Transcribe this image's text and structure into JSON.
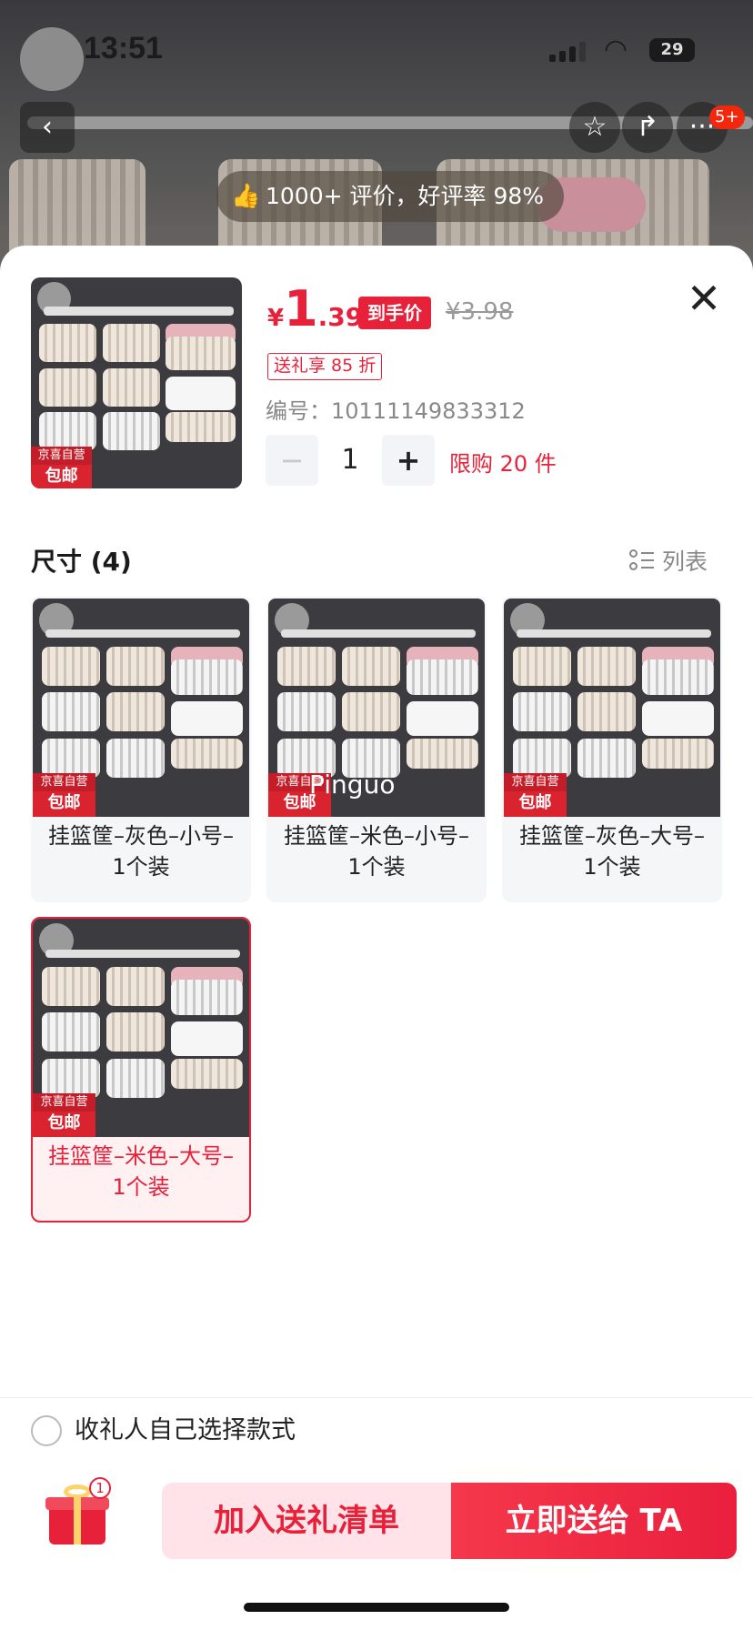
{
  "status_bar": {
    "time": "13:51",
    "battery": "29"
  },
  "header": {
    "message_badge": "5+",
    "rating_text": "1000+ 评价，好评率 98%"
  },
  "product": {
    "currency": "¥",
    "price_int": "1",
    "price_dec": ".39",
    "price_tag": "到手价",
    "price_original": "¥3.98",
    "gift_discount": "送礼享 85 折",
    "sku_number": "编号：10111149833312",
    "quantity": "1",
    "purchase_limit": "限购 20 件"
  },
  "image_tag": {
    "line1": "京喜自营",
    "line2": "包邮"
  },
  "options_section": {
    "title": "尺寸 (4)",
    "view_toggle_label": "列表",
    "options": [
      {
        "label": "挂篮筐–灰色–小号–1个装",
        "selected": false
      },
      {
        "label": "挂篮筐–米色–小号–1个装",
        "selected": false
      },
      {
        "label": "挂篮筐–灰色–大号–1个装",
        "selected": false
      },
      {
        "label": "挂篮筐–米色–大号–1个装",
        "selected": true
      }
    ]
  },
  "watermark": "Pinguo",
  "footer": {
    "recipient_choice_label": "收礼人自己选择款式",
    "gift_count": "1",
    "add_to_list_label": "加入送礼清单",
    "send_now_label": "立即送给 TA"
  },
  "colors": {
    "accent": "#e8213a",
    "selected_bg": "#fff0f2"
  },
  "icons": [
    "back-icon",
    "star-icon",
    "share-icon",
    "more-icon",
    "thumbs-up-icon",
    "close-icon",
    "list-view-icon",
    "gift-icon"
  ]
}
